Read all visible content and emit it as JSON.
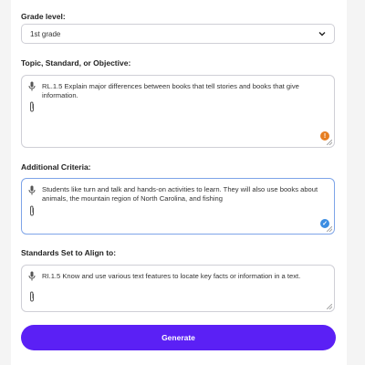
{
  "grade": {
    "label": "Grade level:",
    "selected": "1st grade"
  },
  "topic": {
    "label": "Topic, Standard, or Objective:",
    "value": "RL.1.5 Explain major differences between books that tell stories and books that give information.",
    "badge": "!"
  },
  "criteria": {
    "label": "Additional Criteria:",
    "value": "Students like turn and talk and hands-on activities to learn. They will also use books about animals, the mountain region of North Carolina, and fishing",
    "badge": "✓"
  },
  "standards": {
    "label": "Standards Set to Align to:",
    "value": "RI.1.5 Know and use various text features to locate key facts or information in a text."
  },
  "generate_label": "Generate",
  "colors": {
    "accent": "#5b20f5",
    "warning": "#e67e22",
    "check": "#3b8de2"
  }
}
